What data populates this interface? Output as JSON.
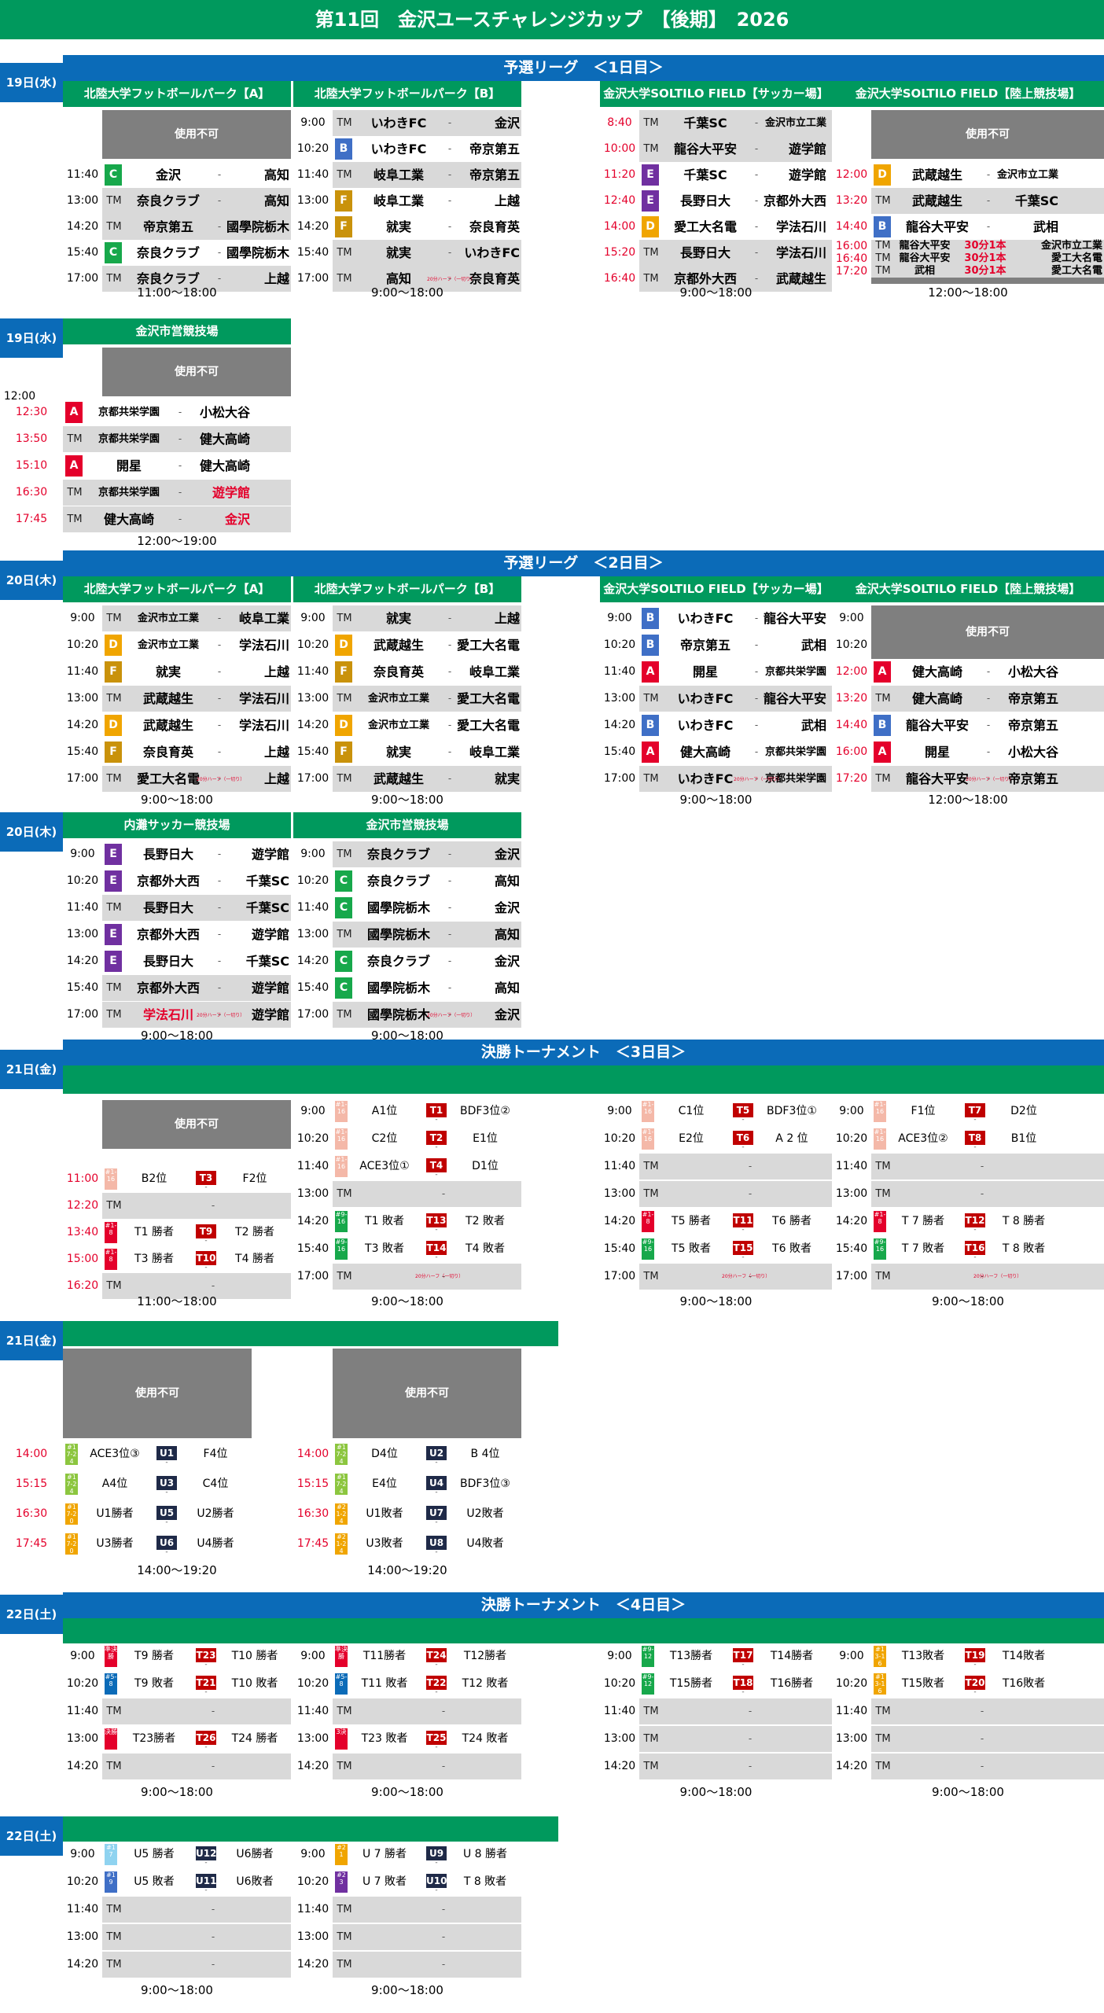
{
  "title": "第11回　金沢ユースチャレンジカップ　【後期】　2026",
  "colors": {
    "green": "#00995d",
    "blue": "#0b6bb8",
    "red": "#e4002b",
    "gray": "#d9d9d9",
    "dark_gray": "#7f7f7f"
  },
  "groups": {
    "A": "#e4002b",
    "B": "#3f6fc6",
    "C": "#17a84b",
    "D": "#f0a500",
    "E": "#7030a0",
    "F": "#c9920b"
  },
  "labels": {
    "unavailable": "使用不可",
    "tm": "TM",
    "dash": "-",
    "extra": "20分ハーフ（一切り）"
  },
  "days": {
    "d1": "19日(水)",
    "d2": "20日(木)",
    "d3": "21日(金)",
    "d4": "22日(土)"
  },
  "stages": {
    "s1": "予選リーグ　＜1日目＞",
    "s2": "予選リーグ　＜2日目＞",
    "s3": "決勝トーナメント　＜3日目＞",
    "s4": "決勝トーナメント　＜4日目＞"
  },
  "venues": {
    "hokuriku_a": "北陸大学フットボールパーク【A】",
    "hokuriku_b": "北陸大学フットボールパーク【B】",
    "soltilo_soccer": "金沢大学SOLTILO FIELD【サッカー場】",
    "soltilo_track": "金沢大学SOLTILO FIELD【陸上競技場】",
    "city": "金沢市営競技場",
    "uchinada": "内灘サッカー競技場"
  },
  "hours": {
    "h1100_1800": "11:00～18:00",
    "h900_1800": "9:00～18:00",
    "h1200_1800": "12:00～18:00",
    "h1200_1900": "12:00～19:00",
    "h1400_1920": "14:00～19:20"
  },
  "day1": {
    "a": {
      "times": [
        "11:40",
        "13:00",
        "14:20",
        "15:40",
        "17:00"
      ],
      "matches": [
        {
          "g": "C",
          "t1": "金沢",
          "t2": "高知"
        },
        {
          "g": "TM",
          "t1": "奈良クラブ",
          "t2": "高知"
        },
        {
          "g": "TM",
          "t1": "帝京第五",
          "t2": "國學院栃木"
        },
        {
          "g": "C",
          "t1": "奈良クラブ",
          "t2": "國學院栃木"
        },
        {
          "g": "TM",
          "t1": "奈良クラブ",
          "t2": "上越"
        }
      ]
    },
    "b": {
      "times": [
        "9:00",
        "10:20",
        "11:40",
        "13:00",
        "14:20",
        "15:40",
        "17:00"
      ],
      "matches": [
        {
          "g": "TM",
          "t1": "いわきFC",
          "t2": "金沢"
        },
        {
          "g": "B",
          "t1": "いわきFC",
          "t2": "帝京第五"
        },
        {
          "g": "TM",
          "t1": "岐阜工業",
          "t2": "帝京第五"
        },
        {
          "g": "F",
          "t1": "岐阜工業",
          "t2": "上越"
        },
        {
          "g": "F",
          "t1": "就実",
          "t2": "奈良育英"
        },
        {
          "g": "TM",
          "t1": "就実",
          "t2": "いわきFC"
        },
        {
          "g": "TM",
          "t1": "高知",
          "t2": "奈良育英"
        }
      ]
    },
    "c": {
      "times": [
        "8:40",
        "10:00",
        "11:20",
        "12:40",
        "14:00",
        "15:20",
        "16:40"
      ],
      "matches": [
        {
          "g": "TM",
          "t1": "千葉SC",
          "t2": "金沢市立工業"
        },
        {
          "g": "TM",
          "t1": "龍谷大平安",
          "t2": "遊学館"
        },
        {
          "g": "E",
          "t1": "千葉SC",
          "t2": "遊学館"
        },
        {
          "g": "E",
          "t1": "長野日大",
          "t2": "京都外大西"
        },
        {
          "g": "D",
          "t1": "愛工大名電",
          "t2": "学法石川"
        },
        {
          "g": "TM",
          "t1": "長野日大",
          "t2": "学法石川"
        },
        {
          "g": "TM",
          "t1": "京都外大西",
          "t2": "武蔵越生"
        }
      ]
    },
    "d": {
      "times": [
        "12:00",
        "13:20",
        "14:40"
      ],
      "matches": [
        {
          "g": "D",
          "t1": "武蔵越生",
          "t2": "金沢市立工業"
        },
        {
          "g": "TM",
          "t1": "武蔵越生",
          "t2": "千葉SC"
        },
        {
          "g": "B",
          "t1": "龍谷大平安",
          "t2": "武相"
        }
      ],
      "extra_times": [
        "16:00",
        "16:40",
        "17:20"
      ],
      "extra": [
        {
          "t1": "龍谷大平安",
          "m": "30分1本",
          "t2": "金沢市立工業"
        },
        {
          "t1": "龍谷大平安",
          "m": "30分1本",
          "t2": "愛工大名電"
        },
        {
          "t1": "武相",
          "m": "30分1本",
          "t2": "愛工大名電"
        }
      ]
    },
    "city": {
      "times": [
        "12:00",
        "12:30",
        "13:50",
        "15:10",
        "16:30",
        "17:45"
      ],
      "matches": [
        {
          "g": "A",
          "t1": "京都共栄学園",
          "t2": "小松大谷"
        },
        {
          "g": "TM",
          "t1": "京都共栄学園",
          "t2": "健大高崎"
        },
        {
          "g": "A",
          "t1": "開星",
          "t2": "健大高崎"
        },
        {
          "g": "TM",
          "t1": "京都共栄学園",
          "t2": "遊学館"
        },
        {
          "g": "TM",
          "t1": "健大高崎",
          "t2": "金沢"
        }
      ]
    }
  },
  "day2": {
    "a": {
      "times": [
        "9:00",
        "10:20",
        "11:40",
        "13:00",
        "14:20",
        "15:40",
        "17:00"
      ],
      "matches": [
        {
          "g": "TM",
          "t1": "金沢市立工業",
          "t2": "岐阜工業"
        },
        {
          "g": "D",
          "t1": "金沢市立工業",
          "t2": "学法石川"
        },
        {
          "g": "F",
          "t1": "就実",
          "t2": "上越"
        },
        {
          "g": "TM",
          "t1": "武蔵越生",
          "t2": "学法石川"
        },
        {
          "g": "D",
          "t1": "武蔵越生",
          "t2": "学法石川"
        },
        {
          "g": "F",
          "t1": "奈良育英",
          "t2": "上越"
        },
        {
          "g": "TM",
          "t1": "愛工大名電",
          "t2": "上越"
        }
      ]
    },
    "b": {
      "times": [
        "9:00",
        "10:20",
        "11:40",
        "13:00",
        "14:20",
        "15:40",
        "17:00"
      ],
      "matches": [
        {
          "g": "TM",
          "t1": "就実",
          "t2": "上越"
        },
        {
          "g": "D",
          "t1": "武蔵越生",
          "t2": "愛工大名電"
        },
        {
          "g": "F",
          "t1": "奈良育英",
          "t2": "岐阜工業"
        },
        {
          "g": "TM",
          "t1": "金沢市立工業",
          "t2": "愛工大名電"
        },
        {
          "g": "D",
          "t1": "金沢市立工業",
          "t2": "愛工大名電"
        },
        {
          "g": "F",
          "t1": "就実",
          "t2": "岐阜工業"
        },
        {
          "g": "TM",
          "t1": "武蔵越生",
          "t2": "就実"
        }
      ]
    },
    "c": {
      "times": [
        "9:00",
        "10:20",
        "11:40",
        "13:00",
        "14:20",
        "15:40",
        "17:00"
      ],
      "matches": [
        {
          "g": "B",
          "t1": "いわきFC",
          "t2": "龍谷大平安"
        },
        {
          "g": "B",
          "t1": "帝京第五",
          "t2": "武相"
        },
        {
          "g": "A",
          "t1": "開星",
          "t2": "京都共栄学園"
        },
        {
          "g": "TM",
          "t1": "いわきFC",
          "t2": "龍谷大平安"
        },
        {
          "g": "B",
          "t1": "いわきFC",
          "t2": "武相"
        },
        {
          "g": "A",
          "t1": "健大高崎",
          "t2": "京都共栄学園"
        },
        {
          "g": "TM",
          "t1": "いわきFC",
          "t2": "京都共栄学園"
        }
      ]
    },
    "d": {
      "times": [
        "9:00",
        "10:20",
        "12:00",
        "13:20",
        "14:40",
        "16:00",
        "17:20"
      ],
      "matches": [
        {
          "g": "A",
          "t1": "健大高崎",
          "t2": "小松大谷"
        },
        {
          "g": "TM",
          "t1": "健大高崎",
          "t2": "帝京第五"
        },
        {
          "g": "B",
          "t1": "龍谷大平安",
          "t2": "帝京第五"
        },
        {
          "g": "A",
          "t1": "開星",
          "t2": "小松大谷"
        },
        {
          "g": "TM",
          "t1": "龍谷大平安",
          "t2": "帝京第五"
        }
      ]
    },
    "uchinada": {
      "times": [
        "9:00",
        "10:20",
        "11:40",
        "13:00",
        "14:20",
        "15:40",
        "17:00"
      ],
      "matches": [
        {
          "g": "E",
          "t1": "長野日大",
          "t2": "遊学館"
        },
        {
          "g": "E",
          "t1": "京都外大西",
          "t2": "千葉SC"
        },
        {
          "g": "TM",
          "t1": "長野日大",
          "t2": "千葉SC"
        },
        {
          "g": "E",
          "t1": "京都外大西",
          "t2": "遊学館"
        },
        {
          "g": "E",
          "t1": "長野日大",
          "t2": "千葉SC"
        },
        {
          "g": "TM",
          "t1": "京都外大西",
          "t2": "遊学館"
        },
        {
          "g": "TM",
          "t1": "学法石川",
          "t2": "遊学館"
        }
      ]
    },
    "city": {
      "times": [
        "9:00",
        "10:20",
        "11:40",
        "13:00",
        "14:20",
        "15:40",
        "17:00"
      ],
      "matches": [
        {
          "g": "TM",
          "t1": "奈良クラブ",
          "t2": "金沢"
        },
        {
          "g": "C",
          "t1": "奈良クラブ",
          "t2": "高知"
        },
        {
          "g": "C",
          "t1": "國學院栃木",
          "t2": "金沢"
        },
        {
          "g": "TM",
          "t1": "國學院栃木",
          "t2": "高知"
        },
        {
          "g": "C",
          "t1": "奈良クラブ",
          "t2": "金沢"
        },
        {
          "g": "C",
          "t1": "國學院栃木",
          "t2": "高知"
        },
        {
          "g": "TM",
          "t1": "國學院栃木",
          "t2": "金沢"
        }
      ]
    }
  },
  "day3": {
    "a": {
      "times": [
        "11:00",
        "12:20",
        "13:40",
        "15:00",
        "16:20"
      ],
      "rows": [
        {
          "tag": "#1-16",
          "t1": "B2位",
          "b": "T3",
          "t2": "F2位"
        },
        {
          "tag": "TM"
        },
        {
          "tag": "#1-8",
          "t1": "T1 勝者",
          "b": "T9",
          "t2": "T2 勝者"
        },
        {
          "tag": "#1-8",
          "t1": "T3 勝者",
          "b": "T10",
          "t2": "T4 勝者"
        },
        {
          "tag": "TM"
        }
      ]
    },
    "b": {
      "times": [
        "9:00",
        "10:20",
        "11:40",
        "13:00",
        "14:20",
        "15:40",
        "17:00"
      ],
      "rows": [
        {
          "tag": "#1-16",
          "t1": "A1位",
          "b": "T1",
          "t2": "BDF3位②"
        },
        {
          "tag": "#1-16",
          "t1": "C2位",
          "b": "T2",
          "t2": "E1位"
        },
        {
          "tag": "#1-16",
          "t1": "ACE3位①",
          "b": "T4",
          "t2": "D1位"
        },
        {
          "tag": "TM"
        },
        {
          "tag": "#9-16",
          "t1": "T1 敗者",
          "b": "T13",
          "t2": "T2 敗者"
        },
        {
          "tag": "#9-16",
          "t1": "T3 敗者",
          "b": "T14",
          "t2": "T4 敗者"
        },
        {
          "tag": "TM"
        }
      ]
    },
    "c": {
      "times": [
        "9:00",
        "10:20",
        "11:40",
        "13:00",
        "14:20",
        "15:40",
        "17:00"
      ],
      "rows": [
        {
          "tag": "#1-16",
          "t1": "C1位",
          "b": "T5",
          "t2": "BDF3位①"
        },
        {
          "tag": "#1-16",
          "t1": "E2位",
          "b": "T6",
          "t2": "A 2 位"
        },
        {
          "tag": "TM"
        },
        {
          "tag": "TM"
        },
        {
          "tag": "#1-8",
          "t1": "T5 勝者",
          "b": "T11",
          "t2": "T6 勝者"
        },
        {
          "tag": "#9-16",
          "t1": "T5 敗者",
          "b": "T15",
          "t2": "T6 敗者"
        },
        {
          "tag": "TM"
        }
      ]
    },
    "d": {
      "times": [
        "9:00",
        "10:20",
        "11:40",
        "13:00",
        "14:20",
        "15:40",
        "17:00"
      ],
      "rows": [
        {
          "tag": "#1-16",
          "t1": "F1位",
          "b": "T7",
          "t2": "D2位"
        },
        {
          "tag": "#1-16",
          "t1": "ACE3位②",
          "b": "T8",
          "t2": "B1位"
        },
        {
          "tag": "TM"
        },
        {
          "tag": "TM"
        },
        {
          "tag": "#1-8",
          "t1": "T 7 勝者",
          "b": "T12",
          "t2": "T 8 勝者"
        },
        {
          "tag": "#9-16",
          "t1": "T 7 敗者",
          "b": "T16",
          "t2": "T 8 敗者"
        },
        {
          "tag": "TM"
        }
      ]
    },
    "e": {
      "times": [
        "14:00",
        "15:15",
        "16:30",
        "17:45"
      ],
      "rows": [
        {
          "tag": "#17-24",
          "t1": "ACE3位③",
          "b": "U1",
          "t2": "F4位"
        },
        {
          "tag": "#17-24",
          "t1": "A4位",
          "b": "U3",
          "t2": "C4位"
        },
        {
          "tag": "#17-20",
          "t1": "U1勝者",
          "b": "U5",
          "t2": "U2勝者"
        },
        {
          "tag": "#17-20",
          "t1": "U3勝者",
          "b": "U6",
          "t2": "U4勝者"
        }
      ]
    },
    "f": {
      "times": [
        "14:00",
        "15:15",
        "16:30",
        "17:45"
      ],
      "rows": [
        {
          "tag": "#17-24",
          "t1": "D4位",
          "b": "U2",
          "t2": "B 4位"
        },
        {
          "tag": "#17-24",
          "t1": "E4位",
          "b": "U4",
          "t2": "BDF3位③"
        },
        {
          "tag": "#21-24",
          "t1": "U1敗者",
          "b": "U7",
          "t2": "U2敗者"
        },
        {
          "tag": "#21-24",
          "t1": "U3敗者",
          "b": "U8",
          "t2": "U4敗者"
        }
      ]
    }
  },
  "day4": {
    "a": {
      "times": [
        "9:00",
        "10:20",
        "11:40",
        "13:00",
        "14:20"
      ],
      "rows": [
        {
          "tag": "準決勝",
          "t1": "T9 勝者",
          "b": "T23",
          "t2": "T10 勝者"
        },
        {
          "tag": "#5-8",
          "t1": "T9 敗者",
          "b": "T21",
          "t2": "T10 敗者"
        },
        {
          "tag": "TM"
        },
        {
          "tag": "決勝",
          "t1": "T23勝者",
          "b": "T26",
          "t2": "T24 勝者"
        },
        {
          "tag": "TM"
        }
      ]
    },
    "b": {
      "times": [
        "9:00",
        "10:20",
        "11:40",
        "13:00",
        "14:20"
      ],
      "rows": [
        {
          "tag": "準決勝",
          "t1": "T11勝者",
          "b": "T24",
          "t2": "T12勝者"
        },
        {
          "tag": "#5-8",
          "t1": "T11 敗者",
          "b": "T22",
          "t2": "T12 敗者"
        },
        {
          "tag": "TM"
        },
        {
          "tag": "3決",
          "t1": "T23 敗者",
          "b": "T25",
          "t2": "T24 敗者"
        },
        {
          "tag": "TM"
        }
      ]
    },
    "c": {
      "times": [
        "9:00",
        "10:20",
        "11:40",
        "13:00",
        "14:20"
      ],
      "rows": [
        {
          "tag": "#9-12",
          "t1": "T13勝者",
          "b": "T17",
          "t2": "T14勝者"
        },
        {
          "tag": "#9-12",
          "t1": "T15勝者",
          "b": "T18",
          "t2": "T16勝者"
        },
        {
          "tag": "TM"
        },
        {
          "tag": "TM"
        },
        {
          "tag": "TM"
        }
      ]
    },
    "d": {
      "times": [
        "9:00",
        "10:20",
        "11:40",
        "13:00",
        "14:20"
      ],
      "rows": [
        {
          "tag": "#13-16",
          "t1": "T13敗者",
          "b": "T19",
          "t2": "T14敗者"
        },
        {
          "tag": "#13-16",
          "t1": "T15敗者",
          "b": "T20",
          "t2": "T16敗者"
        },
        {
          "tag": "TM"
        },
        {
          "tag": "TM"
        },
        {
          "tag": "TM"
        }
      ]
    },
    "e": {
      "times": [
        "9:00",
        "10:20",
        "11:40",
        "13:00",
        "14:20"
      ],
      "rows": [
        {
          "tag": "#17",
          "t1": "U5 勝者",
          "b": "U12",
          "t2": "U6勝者"
        },
        {
          "tag": "#19",
          "t1": "U5 敗者",
          "b": "U11",
          "t2": "U6敗者"
        },
        {
          "tag": "TM"
        },
        {
          "tag": "TM"
        },
        {
          "tag": "TM"
        }
      ]
    },
    "f": {
      "times": [
        "9:00",
        "10:20",
        "11:40",
        "13:00",
        "14:20"
      ],
      "rows": [
        {
          "tag": "#21",
          "t1": "U 7 勝者",
          "b": "U9",
          "t2": "U 8 勝者"
        },
        {
          "tag": "#23",
          "t1": "U 7 敗者",
          "b": "U10",
          "t2": "T 8 敗者"
        },
        {
          "tag": "TM"
        },
        {
          "tag": "TM"
        },
        {
          "tag": "TM"
        }
      ]
    }
  }
}
